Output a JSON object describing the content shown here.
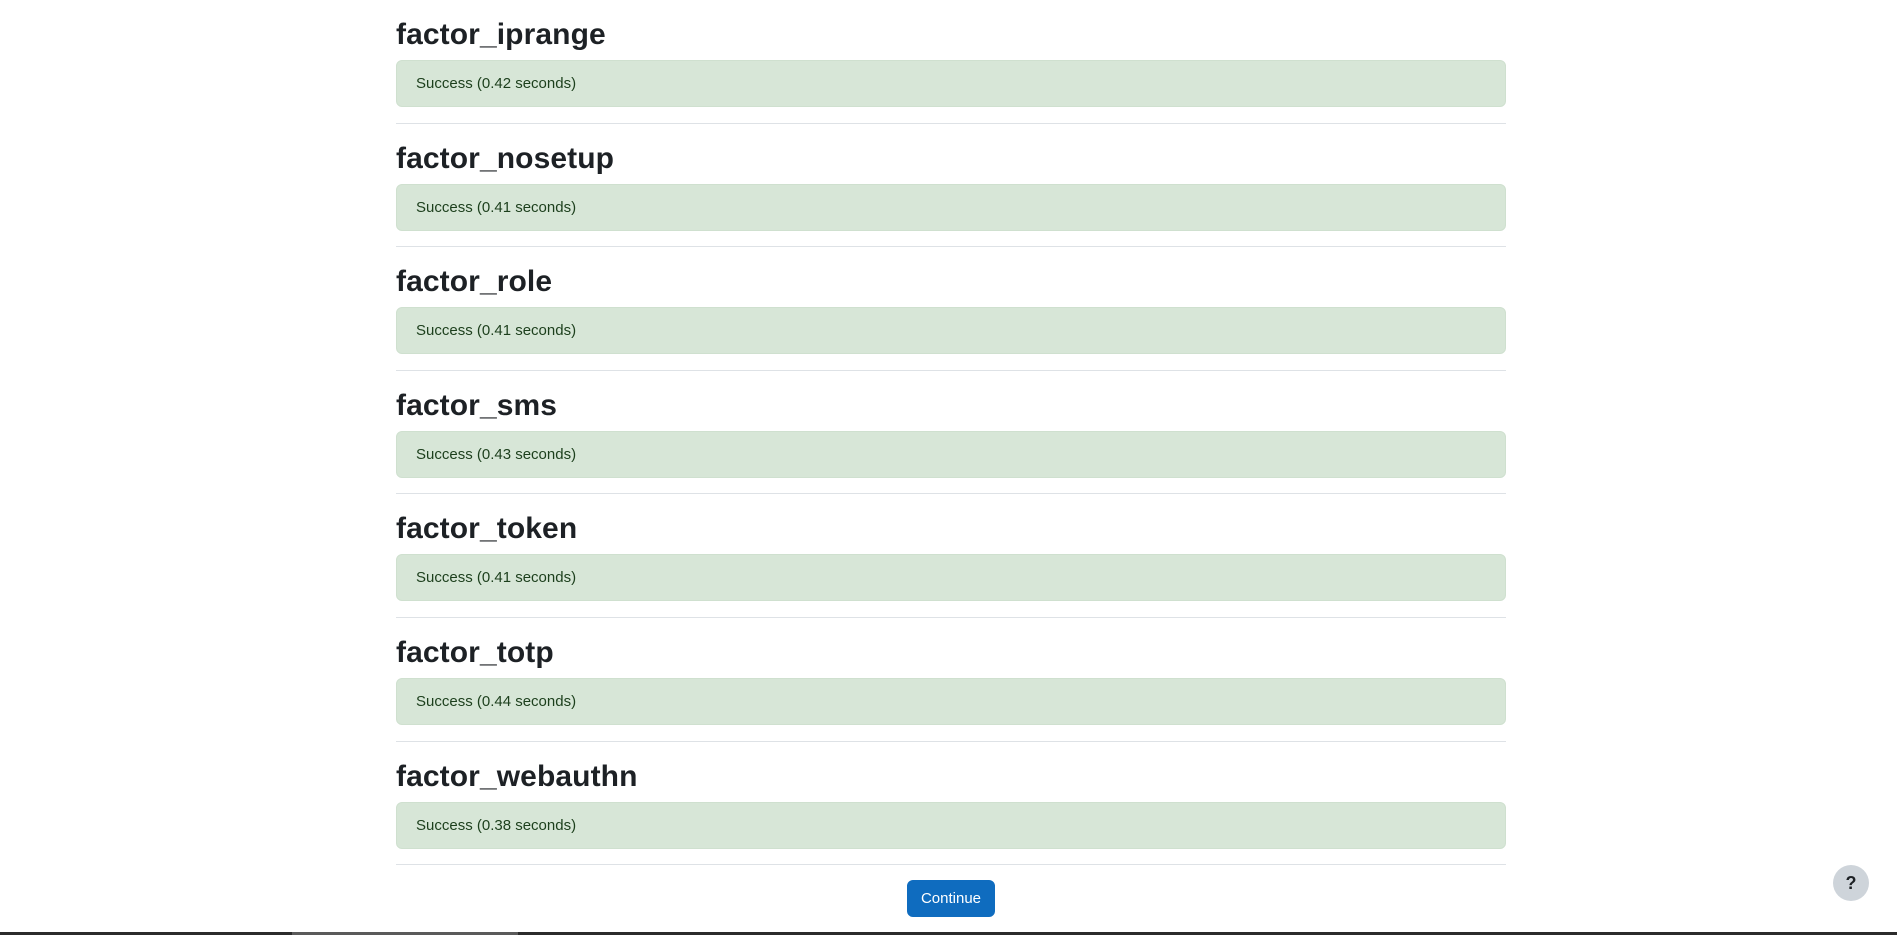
{
  "sections": [
    {
      "title": "factor_iprange",
      "status": "Success (0.42 seconds)"
    },
    {
      "title": "factor_nosetup",
      "status": "Success (0.41 seconds)"
    },
    {
      "title": "factor_role",
      "status": "Success (0.41 seconds)"
    },
    {
      "title": "factor_sms",
      "status": "Success (0.43 seconds)"
    },
    {
      "title": "factor_token",
      "status": "Success (0.41 seconds)"
    },
    {
      "title": "factor_totp",
      "status": "Success (0.44 seconds)"
    },
    {
      "title": "factor_webauthn",
      "status": "Success (0.38 seconds)"
    }
  ],
  "continue_label": "Continue",
  "help_label": "?",
  "colors": {
    "success_bg": "#d7e6d7",
    "success_text": "#1c3f1c",
    "primary": "#0f6cbf"
  }
}
